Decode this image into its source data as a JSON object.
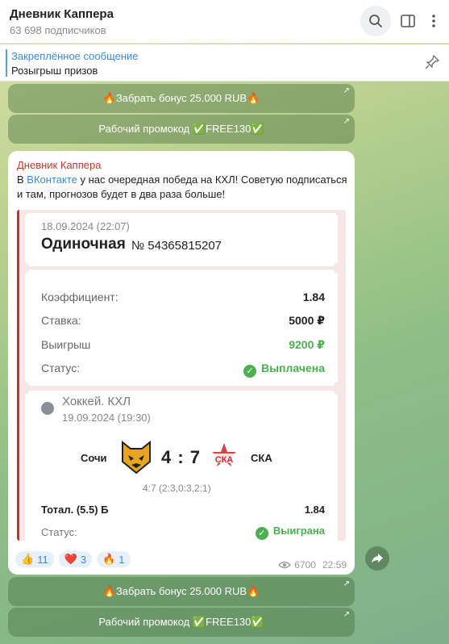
{
  "header": {
    "title": "Дневник Каппера",
    "subscribers": "63 698 подписчиков"
  },
  "pinned": {
    "title": "Закреплённое сообщение",
    "text": "Розыгрыш призов"
  },
  "buttons": {
    "bonus": "🔥Забрать бонус 25.000 RUB🔥",
    "promo": "Рабочий промокод ✅FREE130✅"
  },
  "message": {
    "author": "Дневник Каппера",
    "text_prefix": "В ",
    "text_link": "ВКонтакте",
    "text_suffix": " у нас очередная победа на КХЛ! Советую подписаться и там, прогнозов будет в два раза больше!",
    "views": "6700",
    "time": "22:59"
  },
  "bet": {
    "date": "18.09.2024 (22:07)",
    "type": "Одиночная",
    "number": "№ 54365815207",
    "coef_label": "Коэффициент:",
    "coef_value": "1.84",
    "stake_label": "Ставка:",
    "stake_value": "5000 ₽",
    "win_label": "Выигрыш",
    "win_value": "9200 ₽",
    "status_label": "Статус:",
    "status_value": "Выплачена"
  },
  "event": {
    "sport": "Хоккей. КХЛ",
    "date": "19.09.2024 (19:30)",
    "team1": "Сочи",
    "team2": "СКА",
    "score": "4 : 7",
    "periods": "4:7 (2:3,0:3,2:1)",
    "total_label": "Тотал. (5.5) Б",
    "total_value": "1.84",
    "status_label": "Статус:",
    "status_value": "Выиграна"
  },
  "reactions": [
    {
      "emoji": "👍",
      "count": "11"
    },
    {
      "emoji": "❤️",
      "count": "3"
    },
    {
      "emoji": "🔥",
      "count": "1"
    }
  ],
  "colors": {
    "accent": "#3a8ad1",
    "author": "#c0392b",
    "win_green": "#4caf50"
  }
}
